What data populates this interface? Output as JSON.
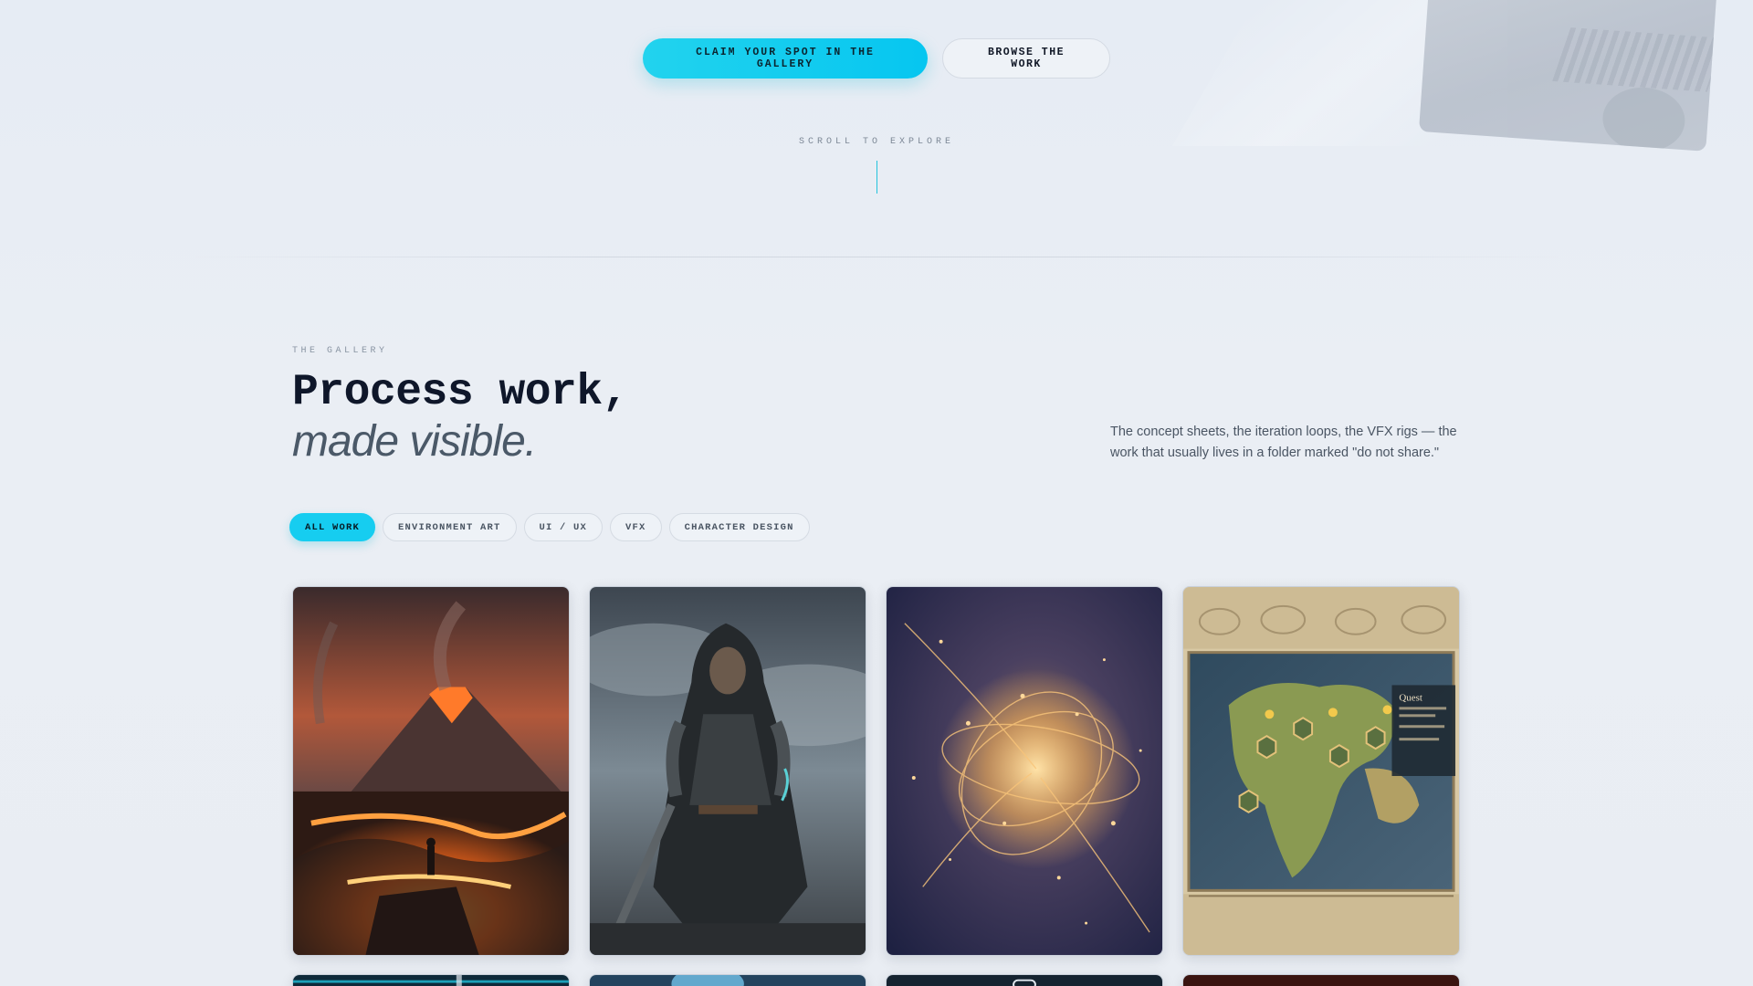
{
  "hero": {
    "primary_cta": "CLAIM YOUR SPOT IN THE GALLERY",
    "secondary_cta": "BROWSE THE WORK",
    "scroll_hint": "SCROLL TO EXPLORE"
  },
  "gallery": {
    "eyebrow": "THE GALLERY",
    "headline_line1": "Process work,",
    "headline_line2": "made visible.",
    "blurb": "The concept sheets, the iteration loops, the VFX rigs — the work that usually lives in a folder marked \"do not share.\"",
    "filters": [
      {
        "label": "ALL WORK",
        "active": true
      },
      {
        "label": "ENVIRONMENT ART",
        "active": false
      },
      {
        "label": "UI / UX",
        "active": false
      },
      {
        "label": "VFX",
        "active": false
      },
      {
        "label": "CHARACTER DESIGN",
        "active": false
      }
    ],
    "map_panel_title": "Quest",
    "items": [
      {
        "subject": "volcanic-landscape",
        "accent": "#ff6a1a"
      },
      {
        "subject": "armored-hooded-warrior",
        "accent": "#5ad1d6"
      },
      {
        "subject": "golden-particle-burst",
        "accent": "#f7b25a"
      },
      {
        "subject": "fantasy-world-map-ui",
        "accent": "#e3c27a"
      },
      {
        "subject": "neon-tech-scene",
        "accent": "#22d3ee"
      },
      {
        "subject": "aurora-scene",
        "accent": "#7dd3fc"
      },
      {
        "subject": "dark-interface-scene",
        "accent": "#e2e8f0"
      },
      {
        "subject": "fire-scene",
        "accent": "#f97316"
      }
    ]
  }
}
